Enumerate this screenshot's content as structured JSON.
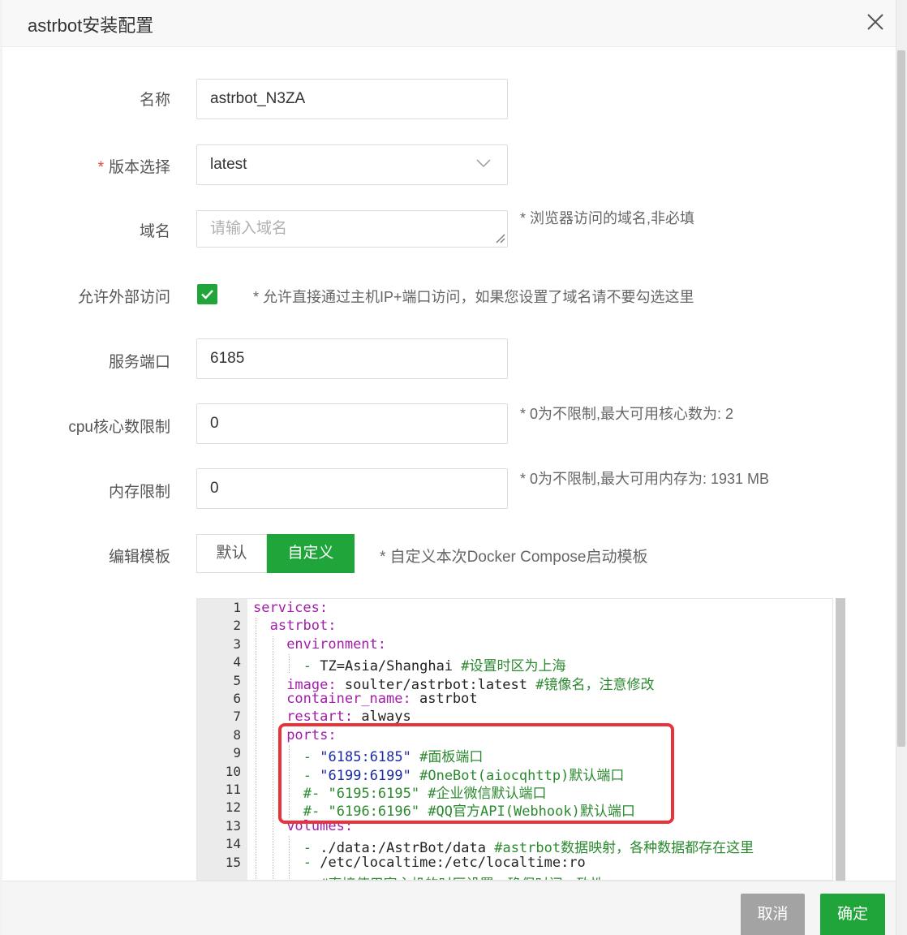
{
  "dialog": {
    "title": "astrbot安装配置"
  },
  "form": {
    "name": {
      "label": "名称",
      "value": "astrbot_N3ZA"
    },
    "version": {
      "required_mark": "*",
      "label": "版本选择",
      "value": "latest"
    },
    "domain": {
      "label": "域名",
      "placeholder": "请输入域名",
      "hint": "* 浏览器访问的域名,非必填"
    },
    "external_access": {
      "label": "允许外部访问",
      "checked": true,
      "hint": "* 允许直接通过主机IP+端口访问，如果您设置了域名请不要勾选这里"
    },
    "service_port": {
      "label": "服务端口",
      "value": "6185"
    },
    "cpu_limit": {
      "label": "cpu核心数限制",
      "value": "0",
      "hint": "* 0为不限制,最大可用核心数为: 2"
    },
    "memory_limit": {
      "label": "内存限制",
      "value": "0",
      "hint": "* 0为不限制,最大可用内存为: 1931 MB"
    },
    "template": {
      "label": "编辑模板",
      "default_label": "默认",
      "custom_label": "自定义",
      "hint": "* 自定义本次Docker Compose启动模板"
    }
  },
  "editor": {
    "line_numbers": [
      "1",
      "2",
      "3",
      "4",
      "5",
      "6",
      "7",
      "8",
      "9",
      "10",
      "11",
      "12",
      "13",
      "14",
      "15"
    ],
    "lines": [
      {
        "key": "services:"
      },
      {
        "key": "astrbot:"
      },
      {
        "key": "environment:"
      },
      {
        "dash": "- ",
        "text": "TZ=Asia/Shanghai ",
        "comment": "#设置时区为上海"
      },
      {
        "key": "image:",
        "text": " soulter/astrbot:latest ",
        "comment": "#镜像名，注意修改"
      },
      {
        "key": "container_name:",
        "text": " astrbot"
      },
      {
        "key": "restart:",
        "text": " always"
      },
      {
        "key": "ports:"
      },
      {
        "dash": "- ",
        "str": "\"6185:6185\"",
        "comment": " #面板端口"
      },
      {
        "dash": "- ",
        "str": "\"6199:6199\"",
        "comment": " #OneBot(aiocqhttp)默认端口"
      },
      {
        "comment": "#- \"6195:6195\" #企业微信默认端口"
      },
      {
        "comment": "#- \"6196:6196\" #QQ官方API(Webhook)默认端口"
      },
      {
        "key": "volumes:"
      },
      {
        "dash": "- ",
        "text": "./data:/AstrBot/data ",
        "comment": "#astrbot数据映射，各种数据都存在这里"
      },
      {
        "dash": "- ",
        "text": "/etc/localtime:/etc/localtime:ro"
      },
      {
        "comment": "#直接使用宿主机的时区设置，确保时间一致性"
      }
    ]
  },
  "footer": {
    "cancel_label": "取消",
    "ok_label": "确定"
  },
  "colors": {
    "accent": "#20a53a",
    "required": "#e8443a",
    "highlight": "#e8333a",
    "yaml_key": "#a31cab",
    "yaml_string": "#1a2aa8",
    "yaml_comment": "#2b8a2f"
  }
}
